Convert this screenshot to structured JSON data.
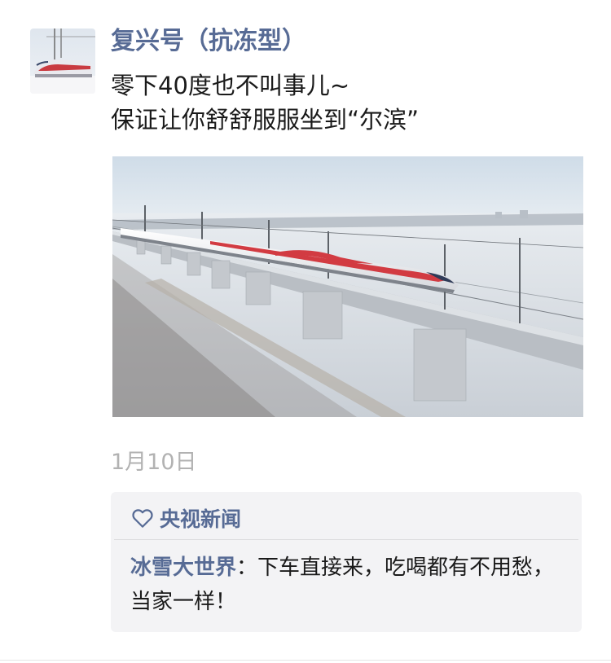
{
  "post": {
    "author": "复兴号（抗冻型）",
    "text_lines": [
      "零下40度也不叫事儿~",
      "保证让你舒舒服服坐到“尔滨”"
    ],
    "image_alt": "high-speed train on snowy viaduct",
    "time": "1月10日"
  },
  "interactions": {
    "like_icon": "heart-outline-icon",
    "likes": "央视新闻",
    "comments": [
      {
        "author": "冰雪大世界",
        "separator": "：",
        "text": "下车直接来，吃喝都有不用愁，当家一样！"
      }
    ]
  },
  "colors": {
    "link": "#576b95",
    "text": "#1a1a1a",
    "time": "#b2b2b2",
    "panel": "#f3f3f5"
  }
}
